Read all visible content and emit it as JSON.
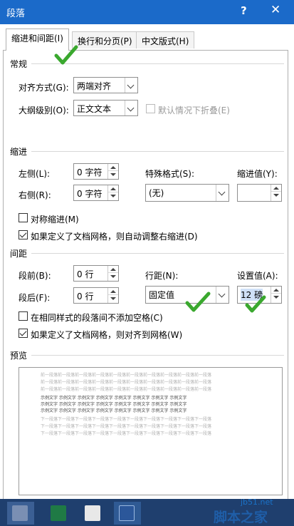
{
  "window": {
    "title": "段落",
    "help": "?",
    "close": "✕"
  },
  "tabs": [
    {
      "label": "缩进和间距(I)"
    },
    {
      "label": "换行和分页(P)"
    },
    {
      "label": "中文版式(H)"
    }
  ],
  "general": {
    "section": "常规",
    "alignment_label": "对齐方式(G):",
    "alignment_value": "两端对齐",
    "outline_label": "大纲级别(O):",
    "outline_value": "正文文本",
    "collapse_label": "默认情况下折叠(E)"
  },
  "indent": {
    "section": "缩进",
    "left_label": "左侧(L):",
    "left_value": "0 字符",
    "right_label": "右侧(R):",
    "right_value": "0 字符",
    "special_label": "特殊格式(S):",
    "special_value": "(无)",
    "by_label": "缩进值(Y):",
    "by_value": "",
    "mirror_label": "对称缩进(M)",
    "auto_adjust_label": "如果定义了文档网格，则自动调整右缩进(D)"
  },
  "spacing": {
    "section": "间距",
    "before_label": "段前(B):",
    "before_value": "0 行",
    "after_label": "段后(F):",
    "after_value": "0 行",
    "line_label": "行距(N):",
    "line_value": "固定值",
    "at_label": "设置值(A):",
    "at_value": "12 磅",
    "no_space_label": "在相同样式的段落间不添加空格(C)",
    "snap_grid_label": "如果定义了文档网格，则对齐到网格(W)"
  },
  "preview": {
    "section": "预览",
    "prev_para": "前一段落前一段落前一段落前一段落前一段落前一段落前一段落前一段落前一段落前一段落",
    "sample": "示例文字 示例文字 示例文字 示例文字 示例文字 示例文字 示例文字 示例文字",
    "next_para": "下一段落下一段落下一段落下一段落下一段落下一段落下一段落下一段落下一段落下一段落"
  },
  "watermark": {
    "site": "jb51.net",
    "name": "脚本之家"
  },
  "colors": {
    "titlebar": "#1b6ac9",
    "check_mark": "#3aa82e",
    "taskbar": "#1f3f6e"
  }
}
